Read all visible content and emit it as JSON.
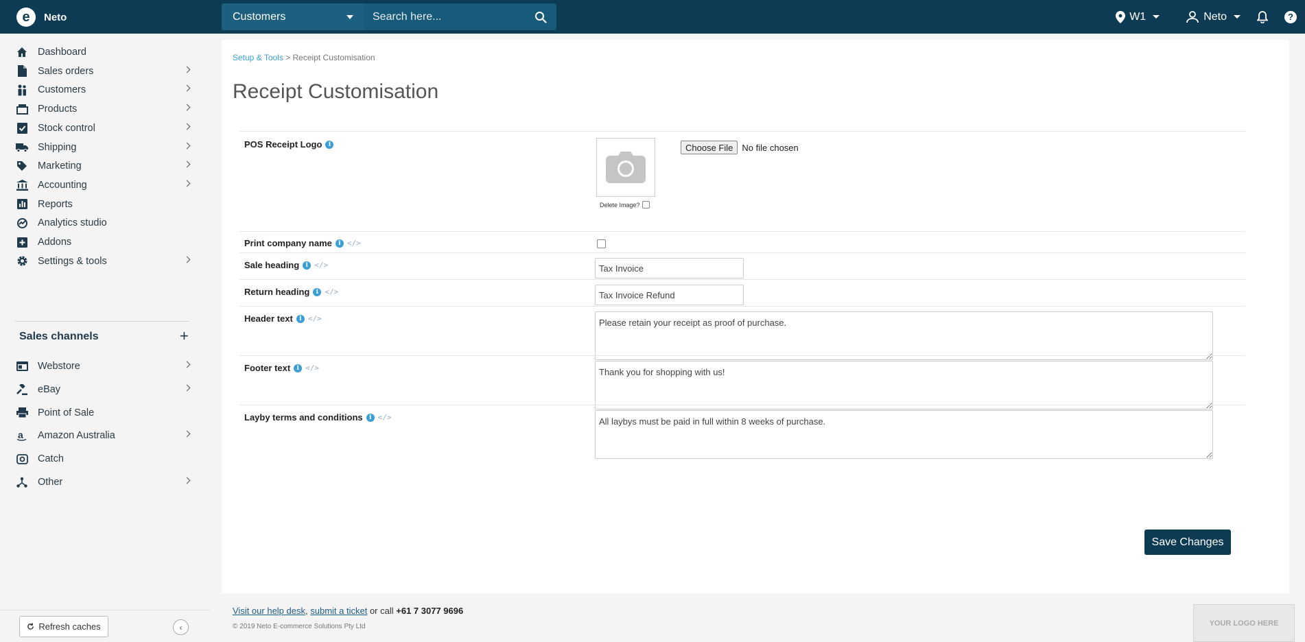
{
  "topbar": {
    "brand_name": "Neto",
    "search_scope": "Customers",
    "search_placeholder": "Search here...",
    "location": "W1",
    "user": "Neto"
  },
  "sidebar": {
    "items": [
      {
        "label": "Dashboard",
        "icon": "home-icon",
        "chevron": false
      },
      {
        "label": "Sales orders",
        "icon": "document-icon",
        "chevron": true
      },
      {
        "label": "Customers",
        "icon": "people-icon",
        "chevron": true
      },
      {
        "label": "Products",
        "icon": "box-icon",
        "chevron": true
      },
      {
        "label": "Stock control",
        "icon": "clipboard-check-icon",
        "chevron": true
      },
      {
        "label": "Shipping",
        "icon": "truck-icon",
        "chevron": true
      },
      {
        "label": "Marketing",
        "icon": "tag-icon",
        "chevron": true
      },
      {
        "label": "Accounting",
        "icon": "bank-icon",
        "chevron": true
      },
      {
        "label": "Reports",
        "icon": "bar-chart-icon",
        "chevron": false
      },
      {
        "label": "Analytics studio",
        "icon": "analytics-icon",
        "chevron": false
      },
      {
        "label": "Addons",
        "icon": "plus-square-icon",
        "chevron": false
      },
      {
        "label": "Settings & tools",
        "icon": "gear-icon",
        "chevron": true
      }
    ],
    "channels_title": "Sales channels",
    "channels": [
      {
        "label": "Webstore",
        "icon": "browser-icon",
        "chevron": true
      },
      {
        "label": "eBay",
        "icon": "gavel-icon",
        "chevron": true
      },
      {
        "label": "Point of Sale",
        "icon": "printer-icon",
        "chevron": false
      },
      {
        "label": "Amazon Australia",
        "icon": "amazon-icon",
        "chevron": true
      },
      {
        "label": "Catch",
        "icon": "catch-icon",
        "chevron": false
      },
      {
        "label": "Other",
        "icon": "network-icon",
        "chevron": true
      }
    ],
    "refresh_label": "Refresh caches"
  },
  "main": {
    "breadcrumb_link": "Setup & Tools",
    "breadcrumb_sep": " > ",
    "breadcrumb_current": "Receipt Customisation",
    "title": "Receipt Customisation",
    "logo_label": "POS Receipt Logo",
    "choose_file": "Choose File",
    "no_file": "No file chosen",
    "delete_image": "Delete Image?",
    "print_company_label": "Print company name",
    "sale_heading_label": "Sale heading",
    "sale_heading_value": "Tax Invoice",
    "return_heading_label": "Return heading",
    "return_heading_value": "Tax Invoice Refund",
    "header_text_label": "Header text",
    "header_text_value": "Please retain your receipt as proof of purchase.",
    "footer_text_label": "Footer text",
    "footer_text_value": "Thank you for shopping with us!",
    "layby_label": "Layby terms and conditions",
    "layby_value": "All laybys must be paid in full within 8 weeks of purchase.",
    "save_label": "Save Changes"
  },
  "footer": {
    "help_link": "Visit our help desk",
    "comma": ",",
    "ticket_link": "submit a ticket",
    "or_call": " or call ",
    "phone": "+61 7 3077 9696",
    "copyright": "© 2019 Neto E-commerce Solutions Pty Ltd",
    "logo_placeholder": "YOUR LOGO HERE"
  },
  "colors": {
    "topbar": "#0d3b53",
    "accent": "#3aa0d3",
    "save_button": "#0d3b53"
  }
}
